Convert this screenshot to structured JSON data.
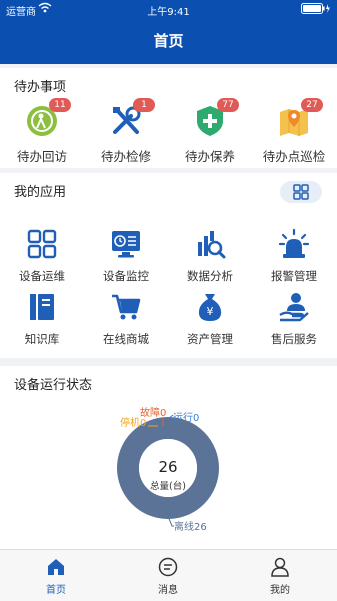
{
  "status_bar": {
    "carrier": "运营商",
    "time": "上午9:41"
  },
  "nav": {
    "title": "首页"
  },
  "todo": {
    "title": "待办事项",
    "items": [
      {
        "label": "待办回访",
        "badge": "11"
      },
      {
        "label": "待办检修",
        "badge": "1"
      },
      {
        "label": "待办保养",
        "badge": "77"
      },
      {
        "label": "待办点巡检",
        "badge": "27"
      }
    ]
  },
  "apps": {
    "title": "我的应用",
    "items": [
      {
        "label": "设备运维"
      },
      {
        "label": "设备监控"
      },
      {
        "label": "数据分析"
      },
      {
        "label": "报警管理"
      },
      {
        "label": "知识库"
      },
      {
        "label": "在线商城"
      },
      {
        "label": "资产管理"
      },
      {
        "label": "售后服务"
      }
    ]
  },
  "device_status": {
    "title": "设备运行状态",
    "center_value": "26",
    "center_label": "总量(台)"
  },
  "chart_data": {
    "type": "pie",
    "categories": [
      "故障",
      "运行",
      "停机",
      "离线"
    ],
    "values": [
      0,
      0,
      0,
      26
    ],
    "labels": [
      "故障0",
      "运行0",
      "停机0",
      "离线26"
    ],
    "colors": [
      "#e8622c",
      "#3a7ed6",
      "#f3a31a",
      "#5b7397"
    ]
  },
  "tabbar": {
    "items": [
      {
        "label": "首页"
      },
      {
        "label": "消息"
      },
      {
        "label": "我的"
      }
    ]
  },
  "colors": {
    "brand": "#0b4fb0",
    "badge": "#e05b56"
  }
}
